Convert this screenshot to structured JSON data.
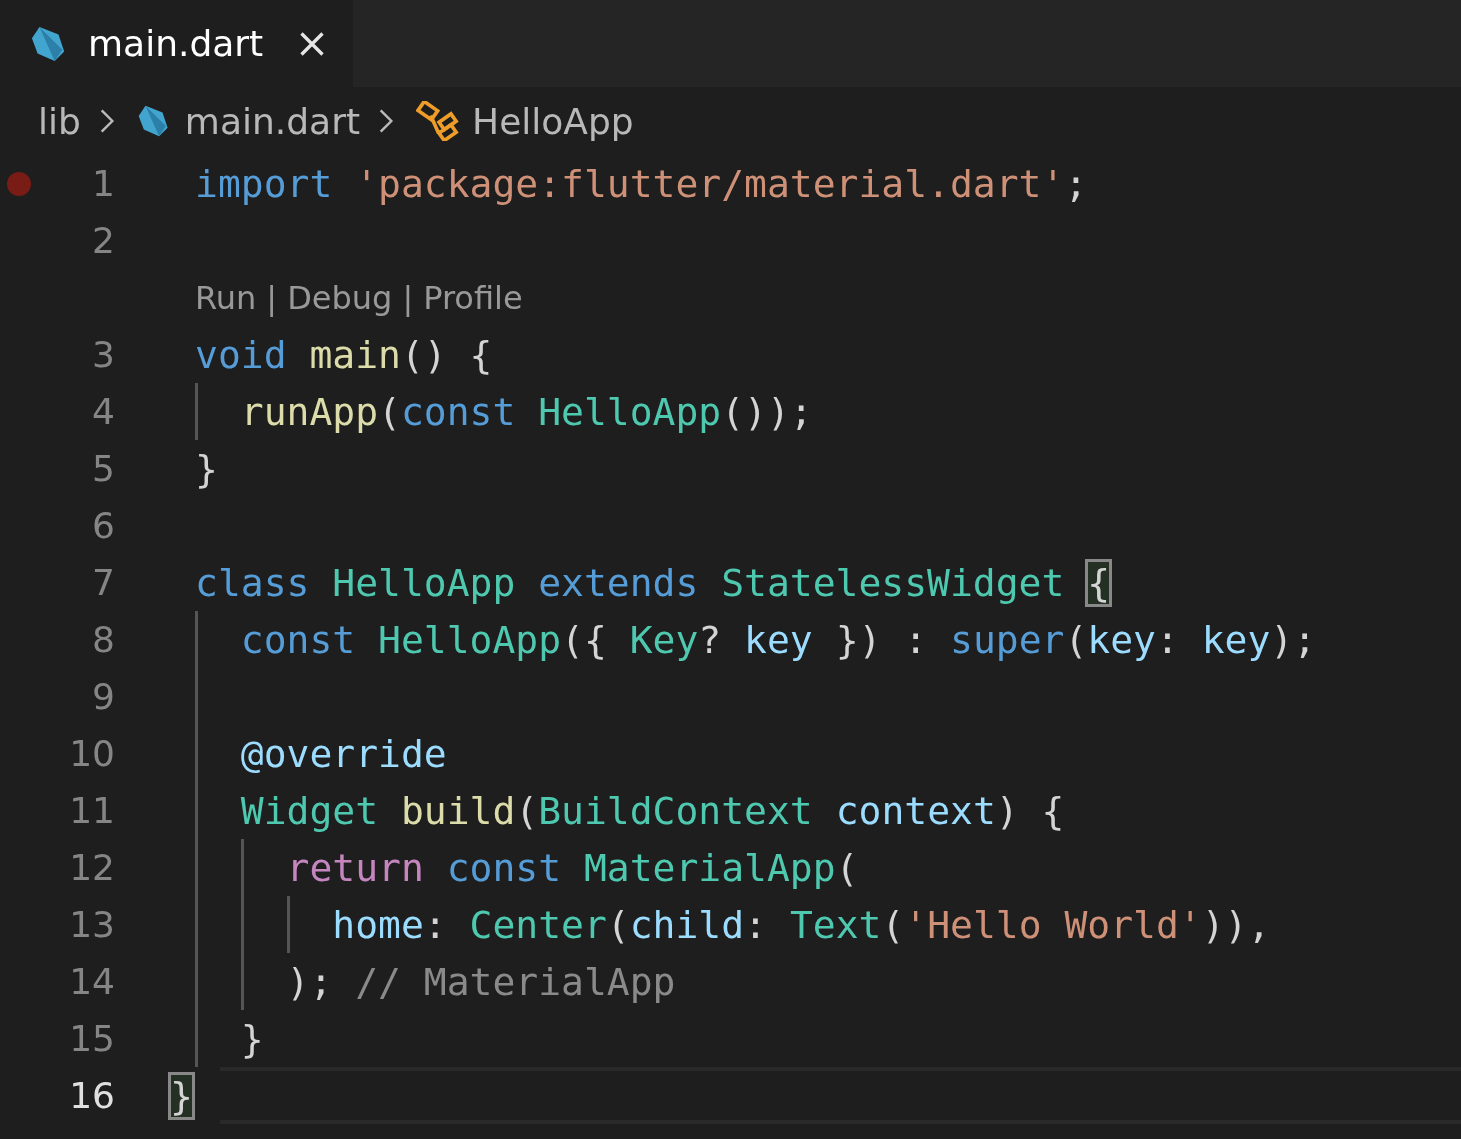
{
  "tabs": [
    {
      "label": "main.dart",
      "selected": true
    }
  ],
  "breadcrumbs": [
    {
      "label": "lib",
      "kind": "folder"
    },
    {
      "label": "main.dart",
      "kind": "file"
    },
    {
      "label": "HelloApp",
      "kind": "class"
    }
  ],
  "lines": [
    {
      "kind": "code",
      "number": "1",
      "breakpoint": true,
      "current": false,
      "tokens": [
        {
          "text": "import",
          "kind": "keyword"
        },
        {
          "text": " 'package:flutter/material.dart'",
          "kind": "string"
        },
        {
          "text": ";",
          "kind": "plain"
        }
      ]
    },
    {
      "kind": "code",
      "number": "2",
      "breakpoint": false,
      "current": false
    },
    {
      "kind": "codelens",
      "links": [
        "Run",
        "Debug",
        "Profile"
      ],
      "separator": "|"
    },
    {
      "kind": "code",
      "number": "3",
      "breakpoint": false,
      "current": false,
      "tokens": [
        {
          "text": "void",
          "kind": "keyword"
        },
        {
          "text": " main",
          "kind": "function"
        },
        {
          "text": "() {",
          "kind": "plain"
        }
      ]
    },
    {
      "kind": "code",
      "number": "4",
      "breakpoint": false,
      "current": false,
      "tokens": [
        {
          "text": "  runApp",
          "kind": "function"
        },
        {
          "text": "(",
          "kind": "plain"
        },
        {
          "text": "const",
          "kind": "keyword"
        },
        {
          "text": " HelloApp",
          "kind": "type"
        },
        {
          "text": "());",
          "kind": "plain"
        }
      ]
    },
    {
      "kind": "code",
      "number": "5",
      "breakpoint": false,
      "current": false,
      "tokens": [
        {
          "text": "}",
          "kind": "plain"
        }
      ]
    },
    {
      "kind": "code",
      "number": "6",
      "breakpoint": false,
      "current": false
    },
    {
      "kind": "code",
      "number": "7",
      "breakpoint": false,
      "current": false,
      "tokens": [
        {
          "text": "class",
          "kind": "keyword"
        },
        {
          "text": " HelloApp",
          "kind": "type"
        },
        {
          "text": " extends",
          "kind": "keyword"
        },
        {
          "text": " StatelessWidget",
          "kind": "type"
        },
        {
          "text": "{",
          "kind": "plain",
          "matched": true
        }
      ]
    },
    {
      "kind": "code",
      "number": "8",
      "breakpoint": false,
      "current": false,
      "tokens": [
        {
          "text": "  const",
          "kind": "keyword"
        },
        {
          "text": " HelloApp",
          "kind": "type"
        },
        {
          "text": "({",
          "kind": "plain"
        },
        {
          "text": " Key",
          "kind": "type"
        },
        {
          "text": "?",
          "kind": "plain"
        },
        {
          "text": " key",
          "kind": "variable"
        },
        {
          "text": " }) :",
          "kind": "plain"
        },
        {
          "text": " super",
          "kind": "keyword"
        },
        {
          "text": "(",
          "kind": "plain"
        },
        {
          "text": "key",
          "kind": "variable"
        },
        {
          "text": ":",
          "kind": "plain"
        },
        {
          "text": " key",
          "kind": "variable"
        },
        {
          "text": ");",
          "kind": "plain"
        }
      ]
    },
    {
      "kind": "code",
      "number": "9",
      "breakpoint": false,
      "current": false
    },
    {
      "kind": "code",
      "number": "10",
      "breakpoint": false,
      "current": false,
      "tokens": [
        {
          "text": "  @override",
          "kind": "variable"
        }
      ]
    },
    {
      "kind": "code",
      "number": "11",
      "breakpoint": false,
      "current": false,
      "tokens": [
        {
          "text": "  Widget",
          "kind": "type"
        },
        {
          "text": " build",
          "kind": "function"
        },
        {
          "text": "(",
          "kind": "plain"
        },
        {
          "text": "BuildContext",
          "kind": "type"
        },
        {
          "text": " context",
          "kind": "variable"
        },
        {
          "text": ") {",
          "kind": "plain"
        }
      ]
    },
    {
      "kind": "code",
      "number": "12",
      "breakpoint": false,
      "current": false,
      "tokens": [
        {
          "text": "    return",
          "kind": "control"
        },
        {
          "text": " const",
          "kind": "keyword"
        },
        {
          "text": " MaterialApp",
          "kind": "type"
        },
        {
          "text": "(",
          "kind": "plain"
        }
      ]
    },
    {
      "kind": "code",
      "number": "13",
      "breakpoint": false,
      "current": false,
      "tokens": [
        {
          "text": "      home",
          "kind": "variable"
        },
        {
          "text": ":",
          "kind": "plain"
        },
        {
          "text": " Center",
          "kind": "type"
        },
        {
          "text": "(",
          "kind": "plain"
        },
        {
          "text": "child",
          "kind": "variable"
        },
        {
          "text": ":",
          "kind": "plain"
        },
        {
          "text": " Text",
          "kind": "type"
        },
        {
          "text": "(",
          "kind": "plain"
        },
        {
          "text": "'Hello World'",
          "kind": "string"
        },
        {
          "text": ")),",
          "kind": "plain"
        }
      ]
    },
    {
      "kind": "code",
      "number": "14",
      "breakpoint": false,
      "current": false,
      "tokens": [
        {
          "text": "    );",
          "kind": "plain"
        },
        {
          "text": " // MaterialApp",
          "kind": "label"
        }
      ]
    },
    {
      "kind": "code",
      "number": "15",
      "breakpoint": false,
      "current": false,
      "tokens": [
        {
          "text": "  }",
          "kind": "plain"
        }
      ]
    },
    {
      "kind": "code",
      "number": "16",
      "breakpoint": false,
      "current": true,
      "tokens": [
        {
          "text": "}",
          "kind": "plain",
          "matched": true
        }
      ]
    }
  ]
}
